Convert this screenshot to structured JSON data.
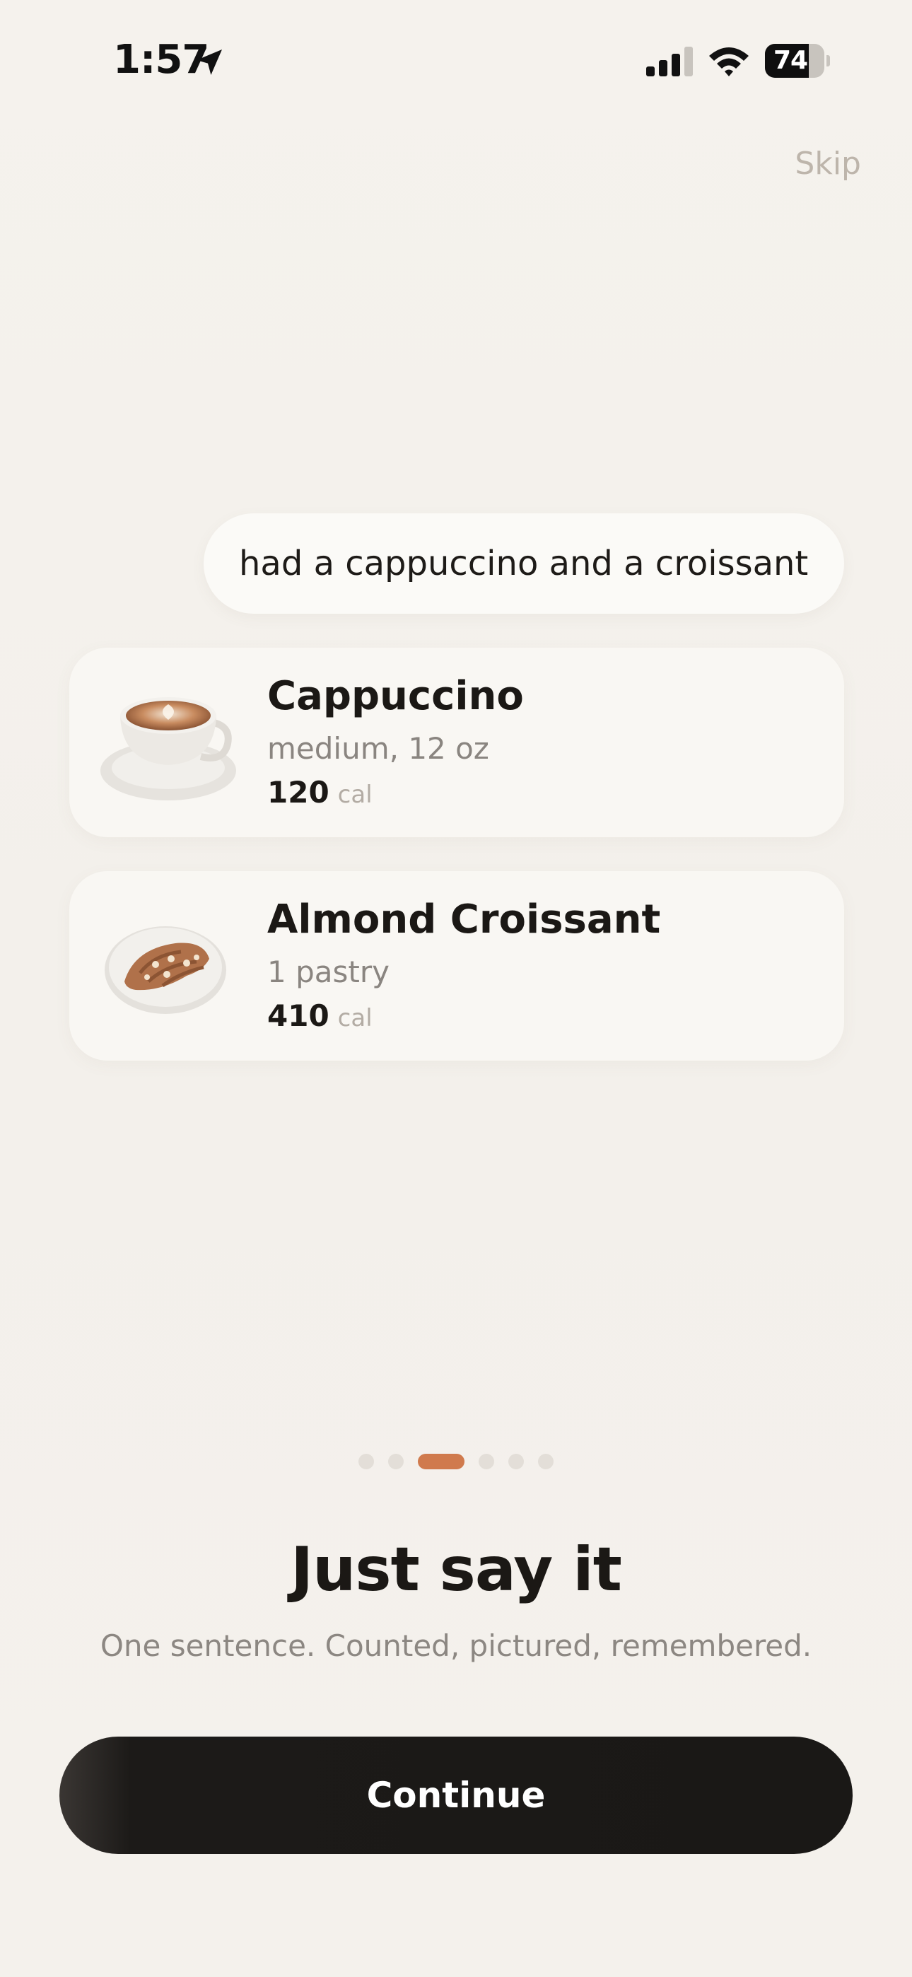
{
  "status_bar": {
    "time": "1:57",
    "battery_percent": "74",
    "battery_level": 0.74,
    "icons": [
      "location-arrow-icon",
      "cellular-signal-icon",
      "wifi-icon",
      "battery-icon"
    ]
  },
  "header": {
    "skip_label": "Skip"
  },
  "chat": {
    "user_message": "had a cappuccino and a croissant"
  },
  "foods": [
    {
      "name": "Cappuccino",
      "portion": "medium, 12 oz",
      "calories": "120",
      "unit": "cal",
      "image": "cappuccino-cup-icon"
    },
    {
      "name": "Almond Croissant",
      "portion": "1 pastry",
      "calories": "410",
      "unit": "cal",
      "image": "croissant-plate-icon"
    }
  ],
  "pagination": {
    "total": 6,
    "current": 3
  },
  "onboarding": {
    "title": "Just say it",
    "subtitle": "One sentence. Counted, pictured, remembered."
  },
  "actions": {
    "continue_label": "Continue"
  },
  "colors": {
    "background": "#f4f1ec",
    "accent": "#d07a4d",
    "button": "#1a1816",
    "card": "#f9f7f3"
  }
}
